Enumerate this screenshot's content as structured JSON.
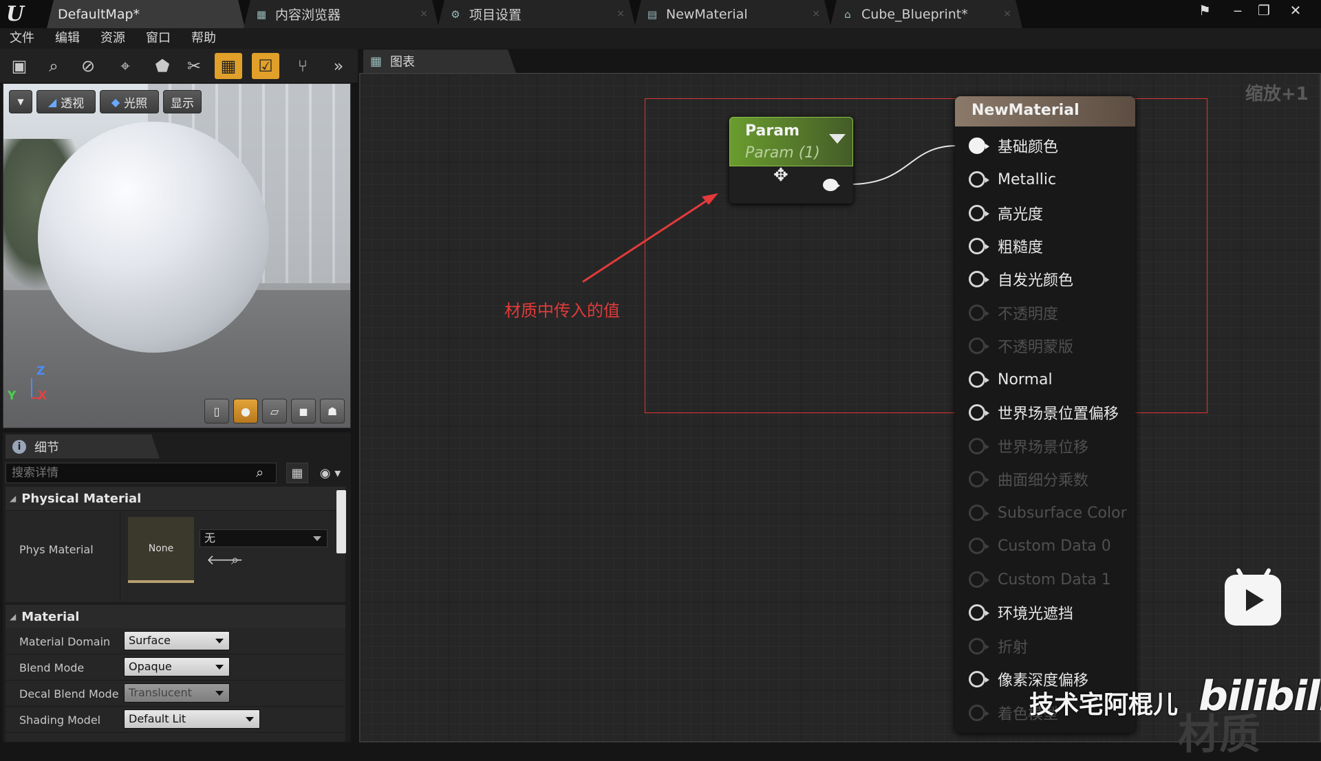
{
  "titlebar": {
    "tabs": [
      {
        "label": "DefaultMap*",
        "active": true
      },
      {
        "label": "内容浏览器",
        "active": false
      },
      {
        "label": "项目设置",
        "active": false
      },
      {
        "label": "NewMaterial",
        "active": false
      },
      {
        "label": "Cube_Blueprint*",
        "active": false
      }
    ]
  },
  "menu": [
    "文件",
    "编辑",
    "资源",
    "窗口",
    "帮助"
  ],
  "viewport": {
    "perspective_label": "透视",
    "lit_label": "光照",
    "show_label": "显示",
    "axis_z": "Z",
    "axis_y": "Y",
    "axis_x": "X"
  },
  "details": {
    "tab_label": "细节",
    "search_placeholder": "搜索详情",
    "physical_material": {
      "header": "Physical Material",
      "phys_material_label": "Phys Material",
      "thumbnail_text": "None",
      "combo_value": "无"
    },
    "material": {
      "header": "Material",
      "rows": [
        {
          "label": "Material Domain",
          "value": "Surface",
          "enabled": true
        },
        {
          "label": "Blend Mode",
          "value": "Opaque",
          "enabled": true
        },
        {
          "label": "Decal Blend Mode",
          "value": "Translucent",
          "enabled": false
        },
        {
          "label": "Shading Model",
          "value": "Default Lit",
          "enabled": true
        }
      ]
    }
  },
  "graph": {
    "tab_label": "图表",
    "zoom_label": "缩放+1",
    "annotation": "材质中传入的值",
    "annotation_color": "#e33a3a",
    "param_node": {
      "title": "Param",
      "subtitle": "Param (1)"
    },
    "material_node": {
      "title": "NewMaterial",
      "pins": [
        {
          "label": "基础颜色",
          "state": "connected"
        },
        {
          "label": "Metallic",
          "state": "enabled"
        },
        {
          "label": "高光度",
          "state": "enabled"
        },
        {
          "label": "粗糙度",
          "state": "enabled"
        },
        {
          "label": "自发光颜色",
          "state": "enabled"
        },
        {
          "label": "不透明度",
          "state": "disabled"
        },
        {
          "label": "不透明蒙版",
          "state": "disabled"
        },
        {
          "label": "Normal",
          "state": "enabled"
        },
        {
          "label": "世界场景位置偏移",
          "state": "enabled"
        },
        {
          "label": "世界场景位移",
          "state": "disabled"
        },
        {
          "label": "曲面细分乘数",
          "state": "disabled"
        },
        {
          "label": "Subsurface Color",
          "state": "disabled"
        },
        {
          "label": "Custom Data 0",
          "state": "disabled"
        },
        {
          "label": "Custom Data 1",
          "state": "disabled"
        },
        {
          "label": "环境光遮挡",
          "state": "enabled"
        },
        {
          "label": "折射",
          "state": "disabled"
        },
        {
          "label": "像素深度偏移",
          "state": "enabled"
        },
        {
          "label": "着色模型",
          "state": "disabled"
        }
      ]
    }
  },
  "watermark": {
    "author": "技术宅阿棍儿",
    "site": "bilibili",
    "bg_text": "材质"
  }
}
